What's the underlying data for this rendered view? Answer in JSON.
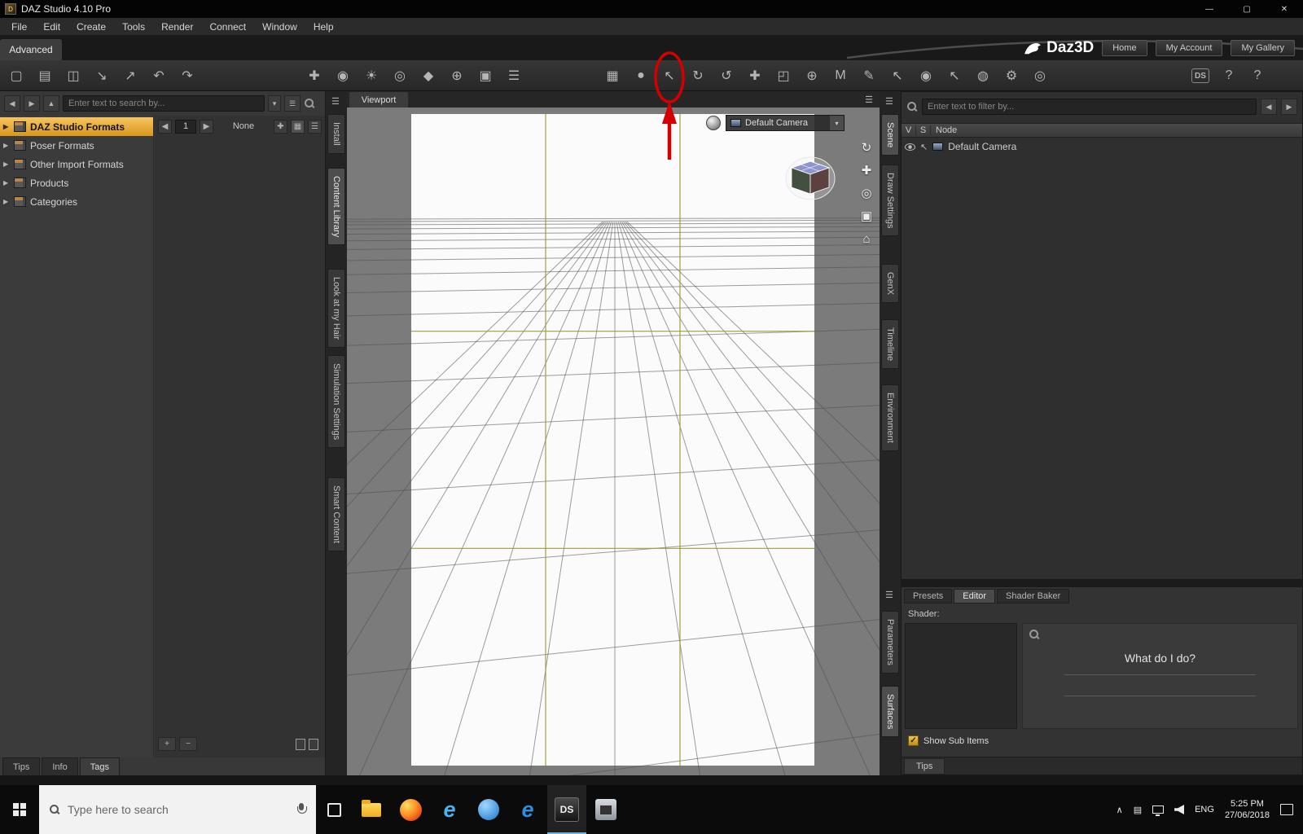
{
  "window": {
    "title": "DAZ Studio 4.10 Pro",
    "minimize": "—",
    "maximize": "▢",
    "close": "✕",
    "icon_glyph": "D"
  },
  "menu": {
    "items": [
      "File",
      "Edit",
      "Create",
      "Tools",
      "Render",
      "Connect",
      "Window",
      "Help"
    ]
  },
  "workspace": {
    "tab": "Advanced"
  },
  "brand": {
    "logo": "Daz3D",
    "home": "Home",
    "account": "My Account",
    "gallery": "My Gallery"
  },
  "icons": {
    "pane_menu": "☰",
    "expand": "▶",
    "dropdown": "▾",
    "back": "◀",
    "forward": "▶",
    "up": "▲",
    "check": "✓",
    "cursor": "↖",
    "hidden_tray": "∧",
    "tray_grid": "▤",
    "add_item": "✚",
    "grid_view": "▦",
    "list_view": "☰"
  },
  "toolbar": {
    "file": [
      {
        "name": "new-file",
        "glyph": "▢"
      },
      {
        "name": "open-file",
        "glyph": "▤"
      },
      {
        "name": "save-file",
        "glyph": "◫"
      },
      {
        "name": "import-file",
        "glyph": "↘"
      },
      {
        "name": "export-file",
        "glyph": "↗"
      },
      {
        "name": "undo",
        "glyph": "↶"
      },
      {
        "name": "redo",
        "glyph": "↷"
      }
    ],
    "create": [
      {
        "name": "new-node",
        "glyph": "✚"
      },
      {
        "name": "new-camera",
        "glyph": "◉"
      },
      {
        "name": "new-light",
        "glyph": "☀"
      },
      {
        "name": "new-spotlight",
        "glyph": "◎"
      },
      {
        "name": "new-primitive",
        "glyph": "◆"
      },
      {
        "name": "new-null",
        "glyph": "⊕"
      },
      {
        "name": "new-group",
        "glyph": "▣"
      },
      {
        "name": "align-tool",
        "glyph": "☰"
      }
    ],
    "tools": [
      {
        "name": "layout-grid-tool",
        "glyph": "▦"
      },
      {
        "name": "draw-style-tool",
        "glyph": "●"
      },
      {
        "name": "node-selection-tool",
        "glyph": "↖"
      },
      {
        "name": "rotate-tool",
        "glyph": "↻"
      },
      {
        "name": "twist-tool",
        "glyph": "↺"
      },
      {
        "name": "translate-tool",
        "glyph": "✚"
      },
      {
        "name": "scale-tool",
        "glyph": "◰"
      },
      {
        "name": "universal-tool",
        "glyph": "⊕"
      },
      {
        "name": "surface-selection-tool",
        "glyph": "M"
      },
      {
        "name": "paint-tool",
        "glyph": "✎"
      },
      {
        "name": "figure-selection-tool",
        "glyph": "↖"
      },
      {
        "name": "camera-selection-tool",
        "glyph": "◉"
      },
      {
        "name": "pointer-tool",
        "glyph": "↖"
      },
      {
        "name": "sphere-tool",
        "glyph": "◍"
      },
      {
        "name": "render-settings",
        "glyph": "⚙"
      },
      {
        "name": "render-button",
        "glyph": "◎"
      }
    ],
    "right": [
      {
        "name": "daz-connect",
        "glyph": "DS"
      },
      {
        "name": "whats-this",
        "glyph": "?"
      },
      {
        "name": "help",
        "glyph": "?"
      }
    ]
  },
  "left_panel": {
    "search_placeholder": "Enter text to search by...",
    "tree": [
      {
        "label": "DAZ Studio Formats"
      },
      {
        "label": "Poser Formats"
      },
      {
        "label": "Other Import Formats"
      },
      {
        "label": "Products"
      },
      {
        "label": "Categories"
      }
    ],
    "page": "1",
    "sort": "None",
    "add": "+",
    "remove": "−",
    "tabs": [
      "Tips",
      "Info",
      "Tags"
    ]
  },
  "left_dock": [
    "Install",
    "Content Library",
    "Look at my Hair",
    "Simulation Settings",
    "Smart Content"
  ],
  "viewport": {
    "tab": "Viewport",
    "camera": "Default Camera",
    "nav": [
      {
        "name": "orbit-tool",
        "glyph": "↻"
      },
      {
        "name": "pan-tool",
        "glyph": "✚"
      },
      {
        "name": "zoom-tool",
        "glyph": "◎"
      },
      {
        "name": "frame-tool",
        "glyph": "▣"
      },
      {
        "name": "reset-view",
        "glyph": "⌂"
      }
    ]
  },
  "right_dock": [
    "Scene",
    "Draw Settings",
    "GenX",
    "Timeline",
    "Environment"
  ],
  "scene_panel": {
    "filter_placeholder": "Enter text to filter by...",
    "col_v": "V",
    "col_s": "S",
    "col_node": "Node",
    "item": "Default Camera"
  },
  "surfaces_panel": {
    "tabs": [
      "Presets",
      "Editor",
      "Shader Baker"
    ],
    "shader_label": "Shader:",
    "message": "What do I do?",
    "show_sub_items": "Show Sub Items",
    "dock": [
      "Parameters",
      "Surfaces"
    ],
    "tips": "Tips"
  },
  "taskbar": {
    "search_placeholder": "Type here to search",
    "apps": [
      {
        "name": "file-explorer",
        "glyph": ""
      },
      {
        "name": "firefox",
        "glyph": ""
      },
      {
        "name": "internet-explorer",
        "glyph": "e"
      },
      {
        "name": "round-app",
        "glyph": ""
      },
      {
        "name": "edge",
        "glyph": "e"
      },
      {
        "name": "daz-studio",
        "glyph": "DS"
      },
      {
        "name": "tool-app",
        "glyph": ""
      }
    ],
    "tray": {
      "lang": "ENG",
      "time": "5:25 PM",
      "date": "27/06/2018"
    }
  },
  "annotation": {
    "color": "#d40000",
    "target": "node-selection-tool"
  }
}
